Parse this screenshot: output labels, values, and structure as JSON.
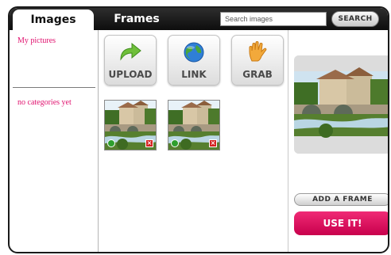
{
  "tabs": {
    "images": "Images",
    "frames": "Frames"
  },
  "search": {
    "placeholder": "Search images",
    "button_label": "SEARCH"
  },
  "sidebar": {
    "my_pictures": "My pictures",
    "no_categories": "no categories yet"
  },
  "actions": [
    {
      "label": "UPLOAD",
      "icon": "arrow-icon"
    },
    {
      "label": "LINK",
      "icon": "globe-icon"
    },
    {
      "label": "GRAB",
      "icon": "hand-icon"
    }
  ],
  "thumbnails": [
    {
      "image": "stone-bridge-village-photo"
    },
    {
      "image": "stone-bridge-village-photo"
    }
  ],
  "preview": {
    "add_frame_label": "ADD A FRAME",
    "use_it_label": "USE IT!"
  },
  "colors": {
    "accent_pink": "#e0116e",
    "use_it_button": "#e0115f",
    "topbar": "#111111",
    "ok_badge": "#2e9f2e",
    "delete_badge": "#d42222"
  }
}
